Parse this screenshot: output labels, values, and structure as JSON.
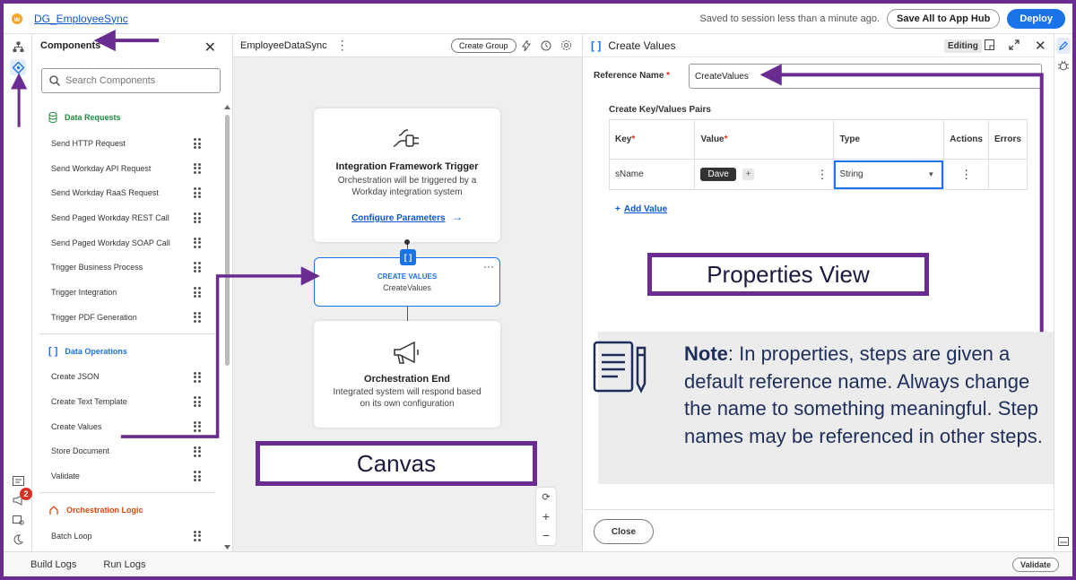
{
  "topbar": {
    "app_title": "DG_EmployeeSync",
    "saved_status": "Saved to session less than a minute ago.",
    "save_all_label": "Save All to App Hub",
    "deploy_label": "Deploy"
  },
  "rail": {
    "notification_count": "2"
  },
  "components": {
    "title": "Components",
    "search_placeholder": "Search Components",
    "sections": [
      {
        "label": "Data Requests",
        "color": "#1e8e3e",
        "items": [
          "Send HTTP Request",
          "Send Workday API Request",
          "Send Workday RaaS Request",
          "Send Paged Workday REST Call",
          "Send Paged Workday SOAP Call",
          "Trigger Business Process",
          "Trigger Integration",
          "Trigger PDF Generation"
        ]
      },
      {
        "label": "Data Operations",
        "color": "#1a73e8",
        "items": [
          "Create JSON",
          "Create Text Template",
          "Create Values",
          "Store Document",
          "Validate"
        ]
      },
      {
        "label": "Orchestration Logic",
        "color": "#d9480f",
        "items": [
          "Batch Loop"
        ]
      }
    ]
  },
  "canvas": {
    "title": "EmployeeDataSync",
    "create_group_label": "Create Group",
    "trigger_card": {
      "title": "Integration Framework Trigger",
      "desc_line1": "Orchestration will be triggered by a",
      "desc_line2": "Workday integration system",
      "link": "Configure Parameters"
    },
    "create_values_card": {
      "icon_text": "[ ]",
      "title": "CREATE VALUES",
      "subtitle": "CreateValues"
    },
    "end_card": {
      "title": "Orchestration End",
      "desc_line1": "Integrated system will respond based",
      "desc_line2": "on its own configuration"
    }
  },
  "properties": {
    "title": "Create Values",
    "title_icon": "[ ]",
    "mode": "Editing",
    "reference_name_label": "Reference Name",
    "reference_name_value": "CreateValues",
    "kv_title": "Create Key/Values Pairs",
    "columns": {
      "key": "Key",
      "value": "Value",
      "type": "Type",
      "actions": "Actions",
      "errors": "Errors"
    },
    "rows": [
      {
        "key": "sName",
        "value": "Dave",
        "type": "String"
      }
    ],
    "add_value_label": "Add Value",
    "close_label": "Close"
  },
  "bottombar": {
    "build_logs": "Build Logs",
    "run_logs": "Run Logs",
    "validate": "Validate"
  },
  "annotations": {
    "canvas_label": "Canvas",
    "properties_label": "Properties View",
    "note_bold": "Note",
    "note_text": ": In properties, steps are given a default reference name. Always change the name to something meaningful.  Step names may be referenced in other steps.",
    "accent_color": "#6a2c91"
  },
  "colors": {
    "primary": "#1a73e8",
    "link": "#0b57d0",
    "required": "#d93025"
  }
}
